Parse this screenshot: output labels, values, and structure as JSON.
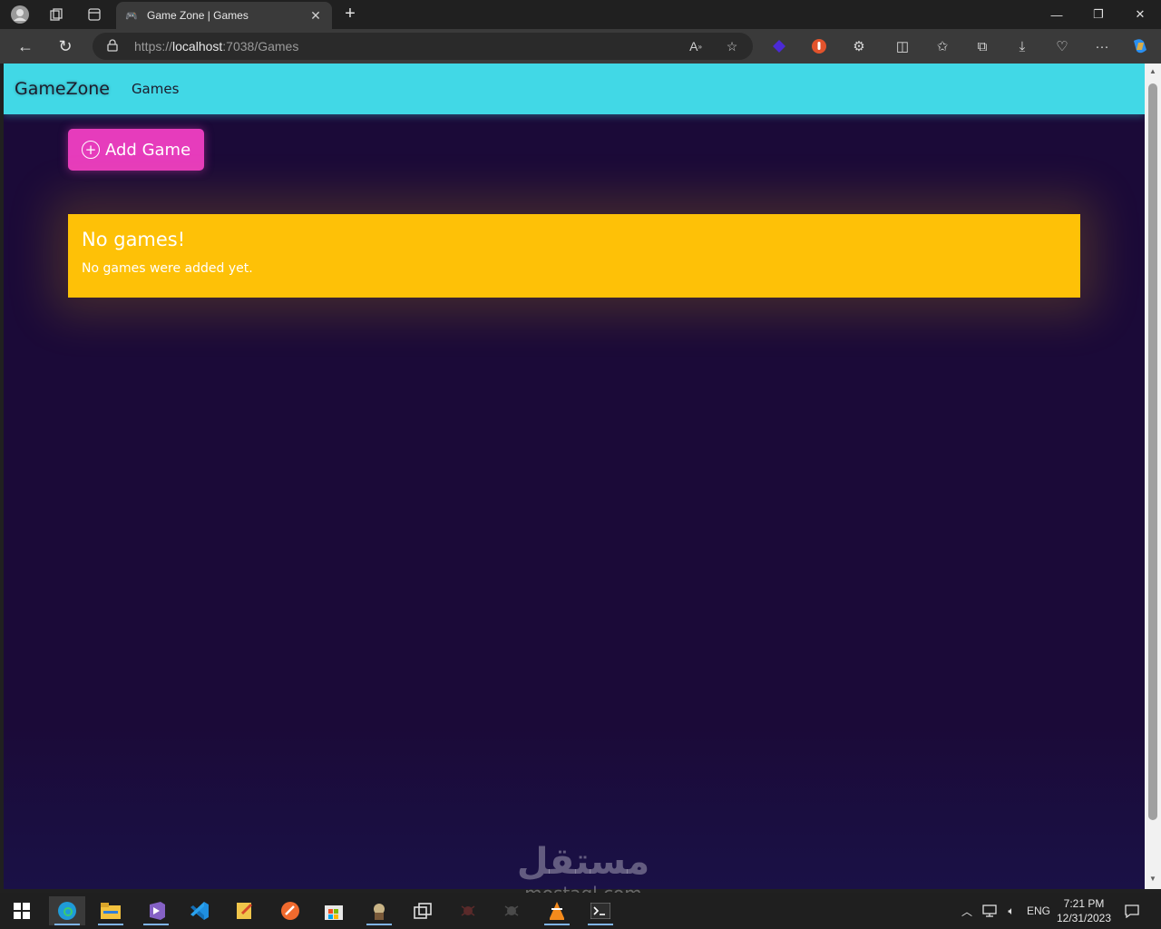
{
  "browser": {
    "tab_title": "Game Zone | Games",
    "tab_favicon": "gamepad-icon",
    "url_prefix": "https://",
    "url_host": "localhost",
    "url_rest": ":7038/Games"
  },
  "navbar": {
    "brand": "GameZone",
    "links": [
      "Games"
    ],
    "color": "#41d8e6"
  },
  "main": {
    "add_button_label": "Add Game",
    "add_button_color": "#e63cbc",
    "alert": {
      "heading": "No games!",
      "message": "No games were added yet.",
      "color": "#fec107"
    },
    "background": "#1b0a38"
  },
  "watermark": {
    "arabic": "مستقل",
    "latin": "mostaql.com"
  },
  "taskbar": {
    "language": "ENG",
    "time": "7:21 PM",
    "date": "12/31/2023"
  }
}
